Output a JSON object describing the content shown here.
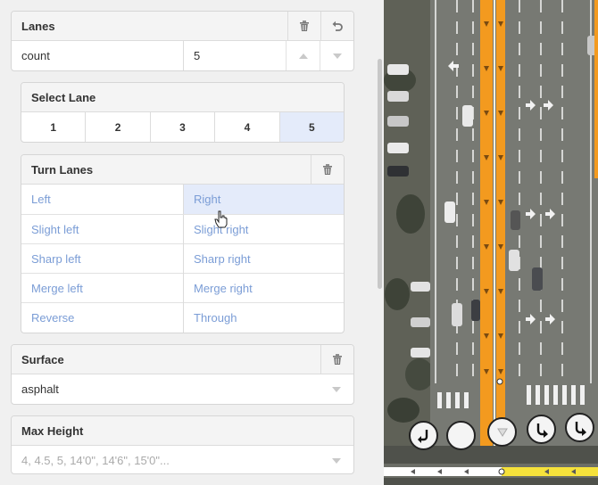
{
  "lanes": {
    "title": "Lanes",
    "count_label": "count",
    "count_value": "5"
  },
  "select_lane": {
    "title": "Select Lane",
    "lanes": [
      "1",
      "2",
      "3",
      "4",
      "5"
    ],
    "active": "5"
  },
  "turn_lanes": {
    "title": "Turn Lanes",
    "options": [
      [
        "Left",
        "Right"
      ],
      [
        "Slight left",
        "Slight right"
      ],
      [
        "Sharp left",
        "Sharp right"
      ],
      [
        "Merge left",
        "Merge right"
      ],
      [
        "Reverse",
        "Through"
      ]
    ]
  },
  "surface": {
    "title": "Surface",
    "value": "asphalt"
  },
  "max_height": {
    "title": "Max Height",
    "placeholder": "4, 4.5, 5, 14'0\", 14'6\", 15'0\"..."
  },
  "colors": {
    "accent": "#7b9dd6",
    "active_bg": "#e4ebfa",
    "road_orange": "#f39a1f",
    "sidewalk_yellow": "#f5e13b"
  },
  "icons": [
    "trash-icon",
    "undo-icon",
    "chevron-up-icon",
    "chevron-down-icon",
    "hand-cursor-icon"
  ]
}
